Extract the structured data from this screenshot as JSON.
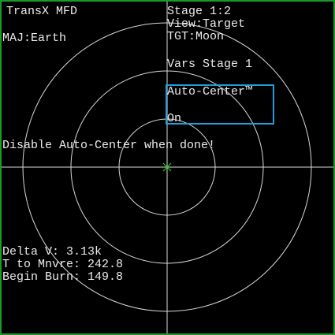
{
  "header": {
    "title": "TransX MFD",
    "stage": "Stage 1:2",
    "view": "View:Target",
    "target": "TGT:Moon",
    "major": "MAJ:Earth"
  },
  "variables": {
    "heading": "Vars Stage 1",
    "selected_variable": "Auto-Center™",
    "selected_value": "On"
  },
  "message": "Disable Auto-Center when done!",
  "readouts": {
    "delta_v": "Delta V: 3.13k",
    "time_to_maneuver": "T to Mnvre: 242.8",
    "begin_burn": "Begin Burn: 149.8"
  },
  "colors": {
    "frame": "#1a9a2a",
    "text": "#ececec",
    "grid": "#d8d8d8",
    "selection": "#1e9fe0",
    "center_marker": "#22cc22"
  }
}
